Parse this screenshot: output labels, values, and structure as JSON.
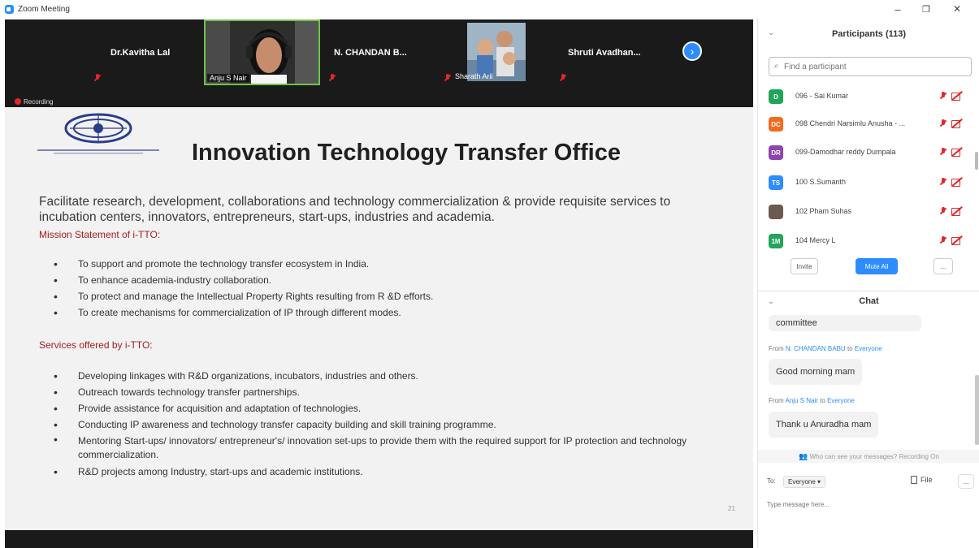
{
  "window": {
    "title": "Zoom Meeting",
    "controls": {
      "minimize": "–",
      "maximize": "❐",
      "close": "✕"
    }
  },
  "video_strip": {
    "tiles": [
      {
        "name": "Dr.Kavitha Lal"
      },
      {
        "name": "Anju S Nair"
      },
      {
        "name": "N. CHANDAN B..."
      },
      {
        "name": "Sharath Aril"
      },
      {
        "name": "Shruti Avadhan..."
      }
    ],
    "next_label": "›",
    "recording_label": "Recording"
  },
  "slide": {
    "title": "Innovation Technology Transfer Office",
    "intro": "Facilitate research, development, collaborations and technology commercialization & provide requisite services to incubation centers, innovators, entrepreneurs, start-ups, industries and academia.",
    "mission_heading": "Mission Statement of i-TTO:",
    "mission_items": [
      "To support and promote the technology transfer ecosystem in India.",
      "To enhance academia-industry collaboration.",
      "To protect and manage the Intellectual Property Rights resulting from R &D efforts.",
      "To create mechanisms for commercialization of IP through different modes."
    ],
    "services_heading": "Services offered by i-TTO:",
    "services_items": [
      "Developing linkages with R&D organizations, incubators, industries and others.",
      "Outreach towards technology transfer partnerships.",
      "Provide assistance for acquisition and adaptation of technologies.",
      "Conducting IP awareness and technology transfer capacity building and skill training programme.",
      "Mentoring Start-ups/ innovators/ entrepreneur's/ innovation set-ups to provide them with the required support for IP protection and technology commercialization.",
      "R&D projects among Industry, start-ups and academic institutions."
    ],
    "page_number": "21"
  },
  "participants": {
    "title": "Participants (113)",
    "search_placeholder": "Find a participant",
    "list": [
      {
        "initials": "D",
        "name": "096 - Sai Kumar",
        "color": "#23a559"
      },
      {
        "initials": "DC",
        "name": "098 Chendri Narsimlu Anusha - ...",
        "color": "#f26b1d"
      },
      {
        "initials": "DR",
        "name": "099-Damodhar reddy Dumpala",
        "color": "#8e44ad"
      },
      {
        "initials": "TS",
        "name": "100 S.Sumanth",
        "color": "#2d8cff"
      },
      {
        "initials": "",
        "name": "102 Pham Suhas",
        "color": "#6b5a4e"
      },
      {
        "initials": "1M",
        "name": "104 Mercy L",
        "color": "#23a559"
      }
    ],
    "invite_label": "Invite",
    "mute_all_label": "Mute All",
    "more_label": "..."
  },
  "chat": {
    "title": "Chat",
    "messages": [
      {
        "text": "committee"
      },
      {
        "from": "N. CHANDAN BABU",
        "to": "Everyone",
        "text": "Good morning mam"
      },
      {
        "from": "Anju S Nair",
        "to": "Everyone",
        "text": "Thank u Anuradha mam"
      }
    ],
    "from_prefix": "From",
    "to_word": "to",
    "info": "Who can see your messages? Recording On",
    "to_label": "To:",
    "recipient": "Everyone ▾",
    "file_label": "File",
    "more_label": "...",
    "input_placeholder": "Type message here..."
  },
  "colors": {
    "accent": "#2d8cff",
    "muted_red": "#e02828",
    "section_red": "#a61c1c",
    "active_border": "#6fc34b"
  }
}
